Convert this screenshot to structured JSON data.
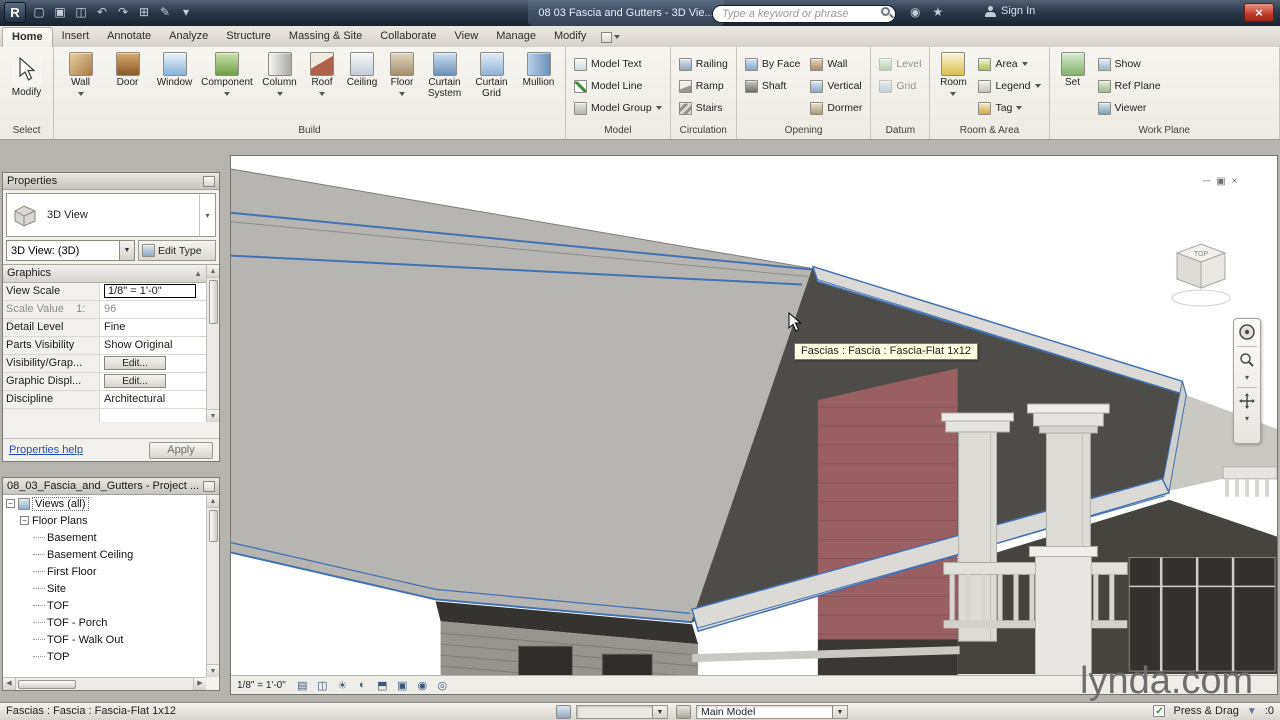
{
  "titlebar": {
    "app_button": "R",
    "qat": [
      {
        "name": "new",
        "glyph": "▢"
      },
      {
        "name": "open",
        "glyph": "▣"
      },
      {
        "name": "save",
        "glyph": "◫"
      },
      {
        "name": "undo",
        "glyph": "↶"
      },
      {
        "name": "redo",
        "glyph": "↷"
      },
      {
        "name": "print",
        "glyph": "⊞"
      },
      {
        "name": "modify",
        "glyph": "✎"
      },
      {
        "name": "customize",
        "glyph": "▾"
      }
    ],
    "title": "08 03 Fascia and Gutters - 3D Vie...",
    "search_placeholder": "Type a keyword or phrase",
    "icons": [
      {
        "name": "communication-center",
        "glyph": "◉"
      },
      {
        "name": "favorites",
        "glyph": "★"
      }
    ],
    "sign_in_label": "Sign In",
    "close_glyph": "×"
  },
  "ribbon": {
    "tabs": [
      "Home",
      "Insert",
      "Annotate",
      "Analyze",
      "Structure",
      "Massing & Site",
      "Collaborate",
      "View",
      "Manage",
      "Modify"
    ],
    "select": {
      "label": "Select",
      "modify": "Modify"
    },
    "build": {
      "label": "Build",
      "items": [
        "Wall",
        "Door",
        "Window",
        "Component",
        "Column",
        "Roof",
        "Ceiling",
        "Floor",
        "Curtain System",
        "Curtain Grid",
        "Mullion"
      ]
    },
    "model": {
      "label": "Model",
      "items": [
        "Model Text",
        "Model Line",
        "Model Group"
      ]
    },
    "circulation": {
      "label": "Circulation",
      "items": [
        "Railing",
        "Ramp",
        "Stairs"
      ]
    },
    "opening": {
      "label": "Opening",
      "col1": [
        "By Face",
        "Shaft"
      ],
      "col2": [
        "Wall",
        "Vertical",
        "Dormer"
      ]
    },
    "datum": {
      "label": "Datum",
      "items": [
        "Level",
        "Grid"
      ]
    },
    "room_area": {
      "label": "Room & Area",
      "big": "Room",
      "items": [
        "Area",
        "Legend",
        "Tag"
      ]
    },
    "work_plane": {
      "label": "Work Plane",
      "big": "Set",
      "items": [
        "Show",
        "Ref Plane",
        "Viewer"
      ]
    }
  },
  "properties": {
    "title": "Properties",
    "type_label": "3D View",
    "selector_value": "3D View: (3D)",
    "edit_type_label": "Edit Type",
    "section": "Graphics",
    "rows": [
      {
        "label": "View Scale",
        "value": "1/8\" = 1'-0\""
      },
      {
        "label": "Scale Value    1:",
        "value": "96"
      },
      {
        "label": "Detail Level",
        "value": "Fine"
      },
      {
        "label": "Parts Visibility",
        "value": "Show Original"
      },
      {
        "label": "Visibility/Grap...",
        "value": "Edit..."
      },
      {
        "label": "Graphic Displ...",
        "value": "Edit..."
      },
      {
        "label": "Discipline",
        "value": "Architectural"
      }
    ],
    "help_link": "Properties help",
    "apply_label": "Apply"
  },
  "browser": {
    "title": "08_03_Fascia_and_Gutters - Project ...",
    "root": "Views (all)",
    "group": "Floor Plans",
    "items": [
      "Basement",
      "Basement Ceiling",
      "First Floor",
      "Site",
      "TOF",
      "TOF - Porch",
      "TOF - Walk Out",
      "TOP"
    ]
  },
  "viewport": {
    "tooltip": "Fascias : Fascia : Fascia-Flat 1x12",
    "viewcube_top": "TOP",
    "watermark": "lynda.com",
    "window_controls": [
      {
        "name": "minimize",
        "glyph": "─"
      },
      {
        "name": "restore",
        "glyph": "▣"
      },
      {
        "name": "close",
        "glyph": "×"
      }
    ]
  },
  "view_controls": {
    "scale": "1/8\" = 1'-0\"",
    "icons": [
      {
        "name": "detail-level",
        "glyph": "▤"
      },
      {
        "name": "visual-style",
        "glyph": "◫"
      },
      {
        "name": "sun-path",
        "glyph": "☀"
      },
      {
        "name": "shadows",
        "glyph": "◐"
      },
      {
        "name": "crop-region",
        "glyph": "⬒"
      },
      {
        "name": "show-crop",
        "glyph": "▣"
      },
      {
        "name": "temporary-hide",
        "glyph": "◉"
      },
      {
        "name": "reveal-hidden",
        "glyph": "◎"
      }
    ]
  },
  "status_bar": {
    "message": "Fascias : Fascia : Fascia-Flat 1x12",
    "main_model": "Main Model",
    "press_drag": "Press & Drag",
    "selection_count": ":0"
  },
  "glyphs": {
    "combo_down": "▼",
    "dd_down": "▾",
    "collapse": "▲",
    "scroll_up": "▲",
    "scroll_down": "▼",
    "scroll_left": "◀",
    "scroll_right": "▶",
    "minus": "−",
    "check": "✓",
    "funnel": "▼"
  },
  "colors": {
    "selection_blue": "#4472b0",
    "tooltip_bg": "#ffffe1",
    "brick": "#9a5f63"
  }
}
